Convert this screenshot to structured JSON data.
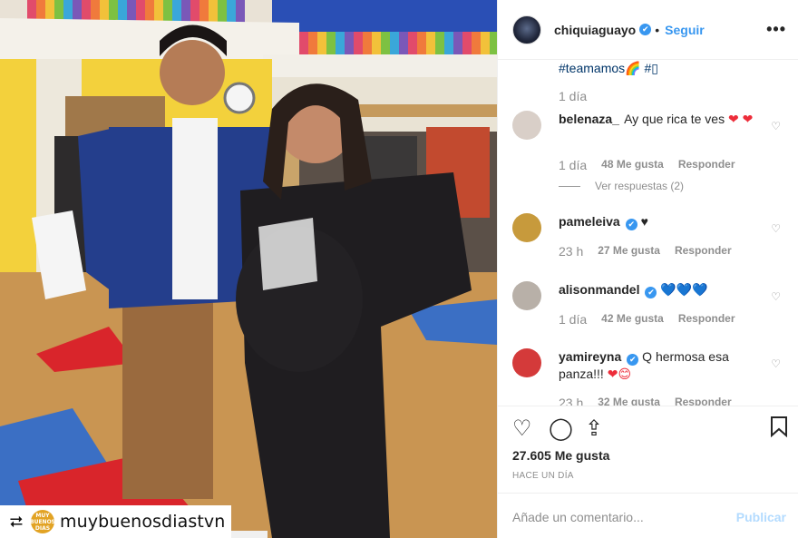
{
  "post": {
    "author": "chiquiaguayo",
    "verified_mark": "✔",
    "separator": "•",
    "follow_label": "Seguir",
    "more_label": "•••",
    "caption_tail": "#teamamos🌈 #▯",
    "caption_time": "1 día"
  },
  "repost": {
    "icon": "⮂",
    "logo_text": "MUY BUENOS DIAS",
    "account": "muybuenosdiastvn"
  },
  "comments": [
    {
      "user": "belenaza_",
      "verified": false,
      "text": "Ay que rica te ves",
      "emoji": "❤ ❤",
      "time": "1 día",
      "likes": "48 Me gusta",
      "reply": "Responder",
      "view_replies": "Ver respuestas (2)",
      "avatar_color": "#d9cfc8"
    },
    {
      "user": "pameleiva",
      "verified": true,
      "text": "",
      "emoji": "♥",
      "time": "23 h",
      "likes": "27 Me gusta",
      "reply": "Responder",
      "avatar_color": "#c79a3c"
    },
    {
      "user": "alisonmandel",
      "verified": true,
      "text": "",
      "emoji": "💙💙💙",
      "time": "1 día",
      "likes": "42 Me gusta",
      "reply": "Responder",
      "avatar_color": "#b8b0a8"
    },
    {
      "user": "yamireyna",
      "verified": true,
      "text": "Q hermosa esa panza!!!",
      "emoji": "❤😊",
      "time": "23 h",
      "likes": "32 Me gusta",
      "reply": "Responder",
      "avatar_color": "#d43a3a"
    }
  ],
  "actions": {
    "like_icon": "♡",
    "comment_icon": "◯",
    "share_icon": "⇪",
    "save_icon": "🔖",
    "likes_count": "27.605 Me gusta",
    "date": "HACE UN DÍA"
  },
  "add_comment": {
    "placeholder": "Añade un comentario...",
    "publish_label": "Publicar"
  },
  "colors": {
    "link_blue": "#3897f0",
    "heart_red": "#ed2d3a",
    "muted_gray": "#8e8e8e"
  }
}
